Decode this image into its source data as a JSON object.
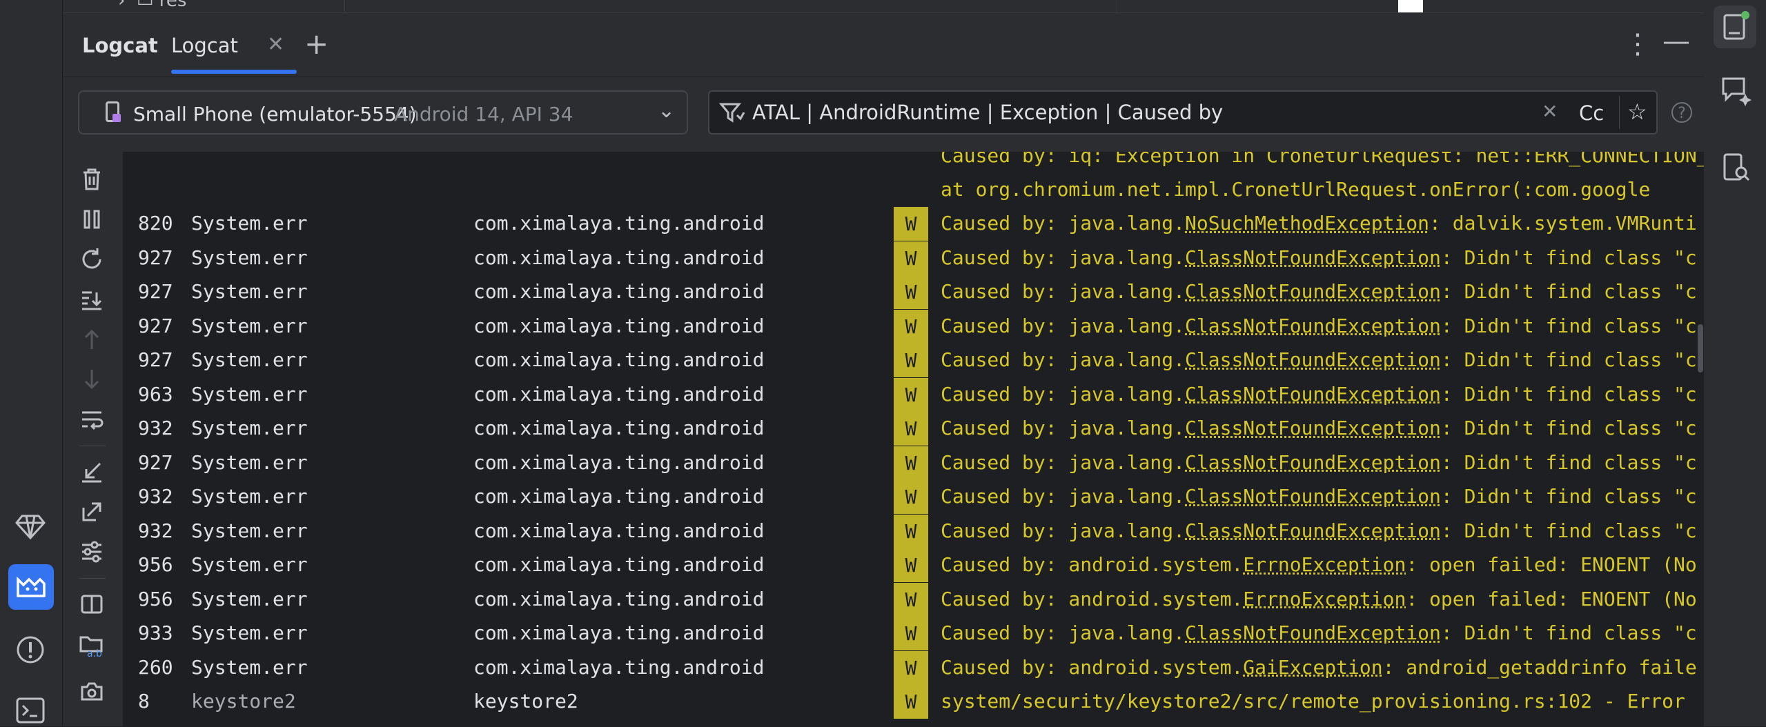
{
  "project_strip": {
    "folder_label": "res"
  },
  "tool_window": {
    "title": "Logcat",
    "tabs": [
      {
        "label": "Logcat"
      }
    ],
    "close_glyph": "✕",
    "add_glyph": "+",
    "more_glyph": "⋮",
    "minimize_glyph": "—"
  },
  "device_selector": {
    "name": "Small Phone (emulator-5554)",
    "api": "Android 14, API 34"
  },
  "filter": {
    "query": "ATAL | AndroidRuntime | Exception | Caused by",
    "clear_glyph": "✕",
    "case_label": "Cc",
    "favorite_glyph": "☆",
    "help_glyph": "?"
  },
  "left_toolbar": {
    "icons": [
      "trash-icon",
      "pause-icon",
      "restart-icon",
      "scroll-to-end-icon",
      "up-icon",
      "down-icon",
      "soft-wrap-icon",
      "collapse-icon",
      "expand-icon",
      "settings-icon",
      "split-icon",
      "folder-ab-icon",
      "camera-icon"
    ]
  },
  "log": {
    "partial_lines": [
      "Caused by: iq: Exception in CronetUrlRequest: net::ERR_CONNECTION_",
      "     at org.chromium.net.impl.CronetUrlRequest.onError(:com.google"
    ],
    "rows": [
      {
        "pid": "820",
        "tag": "System.err",
        "pkg": "com.ximalaya.ting.android",
        "level": "W",
        "prefix": "Caused by: java.lang.",
        "exception": "NoSuchMethodException",
        "suffix": ": dalvik.system.VMRunti"
      },
      {
        "pid": "927",
        "tag": "System.err",
        "pkg": "com.ximalaya.ting.android",
        "level": "W",
        "prefix": "Caused by: java.lang.",
        "exception": "ClassNotFoundException",
        "suffix": ": Didn't find class \"c"
      },
      {
        "pid": "927",
        "tag": "System.err",
        "pkg": "com.ximalaya.ting.android",
        "level": "W",
        "prefix": "Caused by: java.lang.",
        "exception": "ClassNotFoundException",
        "suffix": ": Didn't find class \"c"
      },
      {
        "pid": "927",
        "tag": "System.err",
        "pkg": "com.ximalaya.ting.android",
        "level": "W",
        "prefix": "Caused by: java.lang.",
        "exception": "ClassNotFoundException",
        "suffix": ": Didn't find class \"c"
      },
      {
        "pid": "927",
        "tag": "System.err",
        "pkg": "com.ximalaya.ting.android",
        "level": "W",
        "prefix": "Caused by: java.lang.",
        "exception": "ClassNotFoundException",
        "suffix": ": Didn't find class \"c"
      },
      {
        "pid": "963",
        "tag": "System.err",
        "pkg": "com.ximalaya.ting.android",
        "level": "W",
        "prefix": "Caused by: java.lang.",
        "exception": "ClassNotFoundException",
        "suffix": ": Didn't find class \"c"
      },
      {
        "pid": "932",
        "tag": "System.err",
        "pkg": "com.ximalaya.ting.android",
        "level": "W",
        "prefix": "Caused by: java.lang.",
        "exception": "ClassNotFoundException",
        "suffix": ": Didn't find class \"c"
      },
      {
        "pid": "927",
        "tag": "System.err",
        "pkg": "com.ximalaya.ting.android",
        "level": "W",
        "prefix": "Caused by: java.lang.",
        "exception": "ClassNotFoundException",
        "suffix": ": Didn't find class \"c"
      },
      {
        "pid": "932",
        "tag": "System.err",
        "pkg": "com.ximalaya.ting.android",
        "level": "W",
        "prefix": "Caused by: java.lang.",
        "exception": "ClassNotFoundException",
        "suffix": ": Didn't find class \"c"
      },
      {
        "pid": "932",
        "tag": "System.err",
        "pkg": "com.ximalaya.ting.android",
        "level": "W",
        "prefix": "Caused by: java.lang.",
        "exception": "ClassNotFoundException",
        "suffix": ": Didn't find class \"c"
      },
      {
        "pid": "956",
        "tag": "System.err",
        "pkg": "com.ximalaya.ting.android",
        "level": "W",
        "prefix": "Caused by: android.system.",
        "exception": "ErrnoException",
        "suffix": ": open failed: ENOENT (No"
      },
      {
        "pid": "956",
        "tag": "System.err",
        "pkg": "com.ximalaya.ting.android",
        "level": "W",
        "prefix": "Caused by: android.system.",
        "exception": "ErrnoException",
        "suffix": ": open failed: ENOENT (No"
      },
      {
        "pid": "933",
        "tag": "System.err",
        "pkg": "com.ximalaya.ting.android",
        "level": "W",
        "prefix": "Caused by: java.lang.",
        "exception": "ClassNotFoundException",
        "suffix": ": Didn't find class \"c"
      },
      {
        "pid": "260",
        "tag": "System.err",
        "pkg": "com.ximalaya.ting.android",
        "level": "W",
        "prefix": "Caused by: android.system.",
        "exception": "GaiException",
        "suffix": ": android_getaddrinfo faile"
      },
      {
        "pid": "8",
        "tag": "keystore2",
        "pkg": "keystore2",
        "level": "W",
        "prefix": "system/security/keystore2/src/remote_provisioning.rs:102 - Error",
        "exception": "",
        "suffix": ""
      }
    ]
  },
  "colors": {
    "accent": "#3574f0",
    "warn_badge": "#bfb328",
    "warn_text": "#d6c72a",
    "badge_green": "#5fb865"
  }
}
